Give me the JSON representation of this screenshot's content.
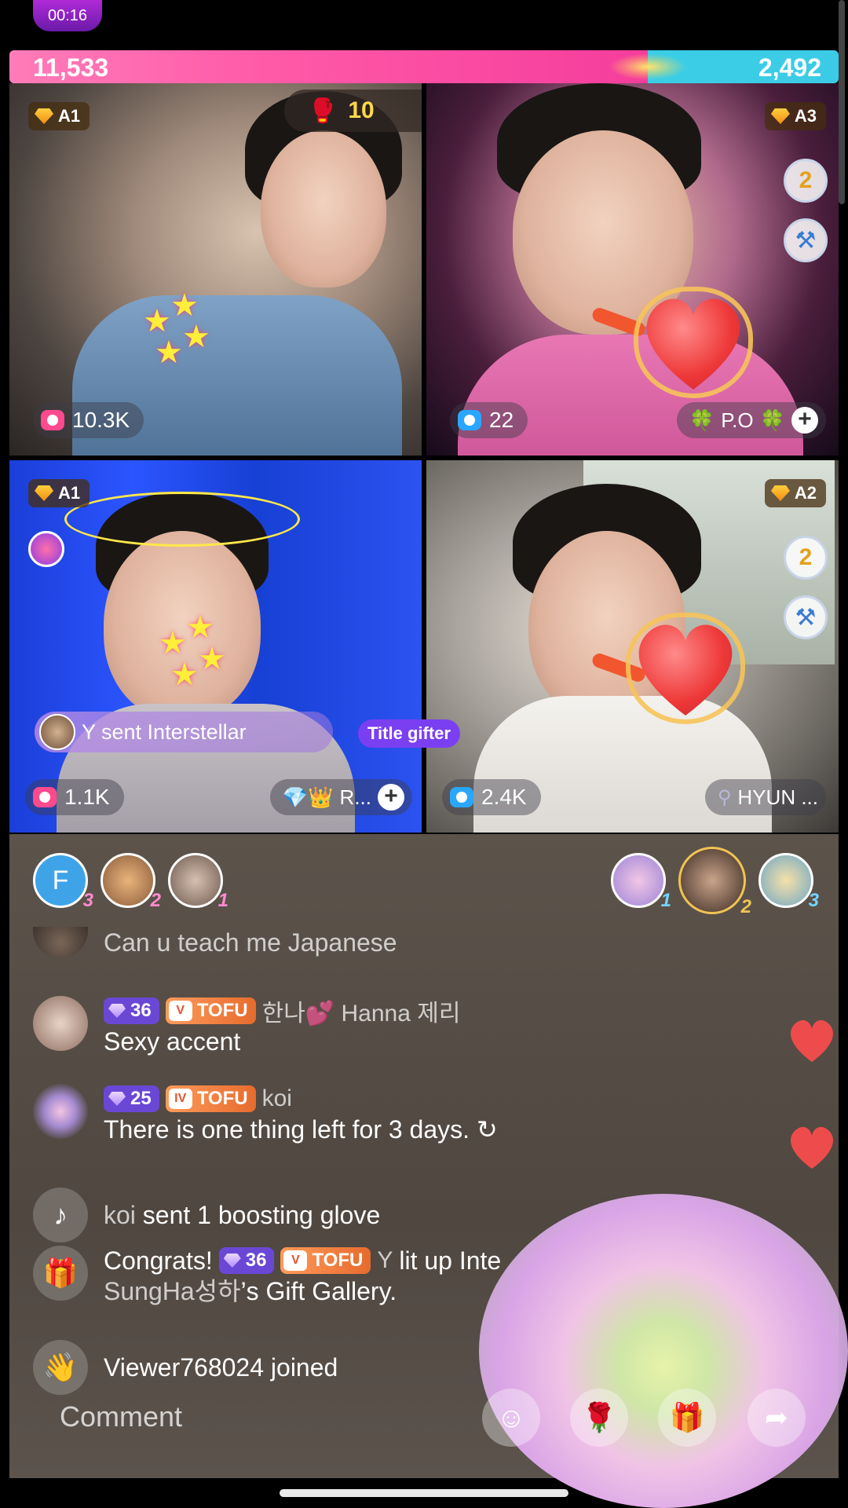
{
  "top": {
    "timer": "00:16"
  },
  "score": {
    "left": "11,533",
    "right": "2,492",
    "pk_left_fraction": 0.77
  },
  "combo": {
    "count": "10"
  },
  "tiles": [
    {
      "level": "A1",
      "viewers": "10.3K"
    },
    {
      "level": "A3",
      "viewers": "22",
      "name": "P.O",
      "name_decor": "🍀"
    },
    {
      "level": "A1",
      "viewers": "1.1K",
      "name": "R...",
      "name_decor": "💎👑"
    },
    {
      "level": "A2",
      "viewers": "2.4K",
      "name": "HYUN ..."
    }
  ],
  "side_icons": {
    "number": "2"
  },
  "gift_banner": {
    "text": "Y sent Interstellar",
    "tag": "Title gifter"
  },
  "top_gifters_left": [
    {
      "initial": "F",
      "rank": "3"
    },
    {
      "rank": "2"
    },
    {
      "rank": "1"
    }
  ],
  "top_gifters_right": [
    {
      "rank": "1"
    },
    {
      "rank": "2"
    },
    {
      "rank": "3"
    }
  ],
  "chat": {
    "partial_message": "Can u teach me Japanese",
    "messages": [
      {
        "level": "36",
        "fan_badge": "TOFU",
        "fan_heart": "V",
        "name": "한나💕 Hanna 제리",
        "text": "Sexy accent"
      },
      {
        "level": "25",
        "fan_badge": "TOFU",
        "fan_heart": "IV",
        "name": "koi",
        "text": "There is one thing left for 3 days. ↻"
      }
    ],
    "system": [
      {
        "name": "koi",
        "text": "sent 1 boosting glove"
      },
      {
        "prefix": "Congrats!",
        "level": "36",
        "fan_badge": "TOFU",
        "fan_heart": "V",
        "name": "Y",
        "text_1": "lit up Inte",
        "line_2_name": "SungHa성하",
        "line_2_rest": "’s Gift Gallery."
      },
      {
        "text": "Viewer768024 joined"
      }
    ]
  },
  "bottom": {
    "comment_placeholder": "Comment"
  }
}
